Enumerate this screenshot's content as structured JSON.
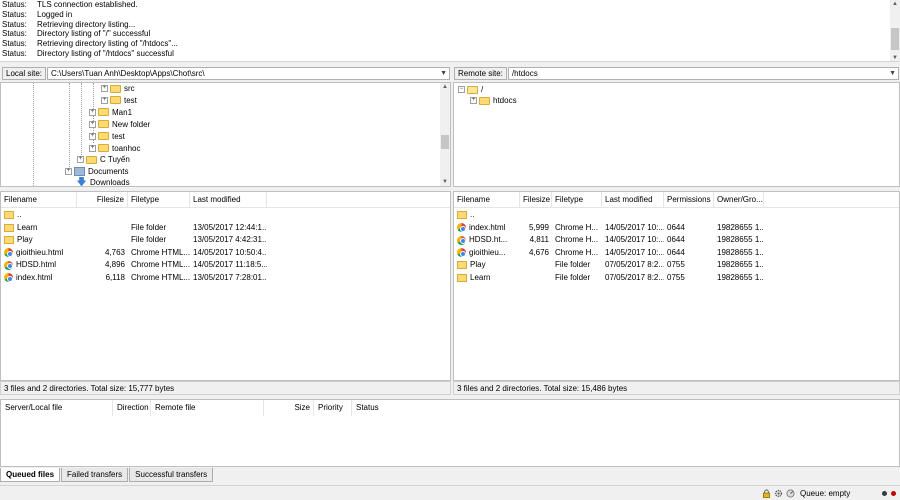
{
  "message_log": [
    {
      "kind": "Status:",
      "text": "TLS connection established."
    },
    {
      "kind": "Status:",
      "text": "Logged in"
    },
    {
      "kind": "Status:",
      "text": "Retrieving directory listing..."
    },
    {
      "kind": "Status:",
      "text": "Directory listing of \"/\" successful"
    },
    {
      "kind": "Status:",
      "text": "Retrieving directory listing of \"/htdocs\"..."
    },
    {
      "kind": "Status:",
      "text": "Directory listing of \"/htdocs\" successful"
    }
  ],
  "local": {
    "site_label": "Local site:",
    "path": "C:\\Users\\Tuan Anh\\Desktop\\Apps\\Chot\\src\\",
    "tree": [
      {
        "label": "src",
        "icon": "folder-icon"
      },
      {
        "label": "test",
        "icon": "folder-icon"
      },
      {
        "label": "Man1",
        "icon": "folder-icon"
      },
      {
        "label": "New folder",
        "icon": "folder-icon"
      },
      {
        "label": "test",
        "icon": "folder-icon"
      },
      {
        "label": "toanhoc",
        "icon": "folder-icon"
      },
      {
        "label": "C Tuyến",
        "icon": "folder-icon"
      },
      {
        "label": "Documents",
        "icon": "documents-icon"
      },
      {
        "label": "Downloads",
        "icon": "download-icon"
      }
    ],
    "columns": [
      "Filename",
      "Filesize",
      "Filetype",
      "Last modified"
    ],
    "files": [
      {
        "name": "..",
        "size": "",
        "type": "",
        "modified": "",
        "icon": "folder"
      },
      {
        "name": "Learn",
        "size": "",
        "type": "File folder",
        "modified": "13/05/2017 12:44:1...",
        "icon": "folder"
      },
      {
        "name": "Play",
        "size": "",
        "type": "File folder",
        "modified": "13/05/2017 4:42:31...",
        "icon": "folder"
      },
      {
        "name": "gioithieu.html",
        "size": "4,763",
        "type": "Chrome HTML...",
        "modified": "14/05/2017 10:50:4...",
        "icon": "chrome"
      },
      {
        "name": "HDSD.html",
        "size": "4,896",
        "type": "Chrome HTML...",
        "modified": "14/05/2017 11:18:5...",
        "icon": "chrome"
      },
      {
        "name": "index.html",
        "size": "6,118",
        "type": "Chrome HTML...",
        "modified": "13/05/2017 7:28:01...",
        "icon": "chrome"
      }
    ],
    "status": "3 files and 2 directories. Total size: 15,777 bytes"
  },
  "remote": {
    "site_label": "Remote site:",
    "path": "/htdocs",
    "tree": [
      {
        "label": "/",
        "icon": "folder-icon"
      },
      {
        "label": "htdocs",
        "icon": "folder-icon"
      }
    ],
    "columns": [
      "Filename",
      "Filesize",
      "Filetype",
      "Last modified",
      "Permissions",
      "Owner/Gro..."
    ],
    "files": [
      {
        "name": "..",
        "size": "",
        "type": "",
        "modified": "",
        "perm": "",
        "owner": "",
        "icon": "folder"
      },
      {
        "name": "index.html",
        "size": "5,999",
        "type": "Chrome H...",
        "modified": "14/05/2017 10:...",
        "perm": "0644",
        "owner": "19828655 1...",
        "icon": "chrome"
      },
      {
        "name": "HDSD.ht...",
        "size": "4,811",
        "type": "Chrome H...",
        "modified": "14/05/2017 10:...",
        "perm": "0644",
        "owner": "19828655 1...",
        "icon": "chrome"
      },
      {
        "name": "gioithieu...",
        "size": "4,676",
        "type": "Chrome H...",
        "modified": "14/05/2017 10:...",
        "perm": "0644",
        "owner": "19828655 1...",
        "icon": "chrome"
      },
      {
        "name": "Play",
        "size": "",
        "type": "File folder",
        "modified": "07/05/2017 8:2...",
        "perm": "0755",
        "owner": "19828655 1...",
        "icon": "folder"
      },
      {
        "name": "Learn",
        "size": "",
        "type": "File folder",
        "modified": "07/05/2017 8:2...",
        "perm": "0755",
        "owner": "19828655 1...",
        "icon": "folder"
      }
    ],
    "status": "3 files and 2 directories. Total size: 15,486 bytes"
  },
  "queue": {
    "columns": [
      "Server/Local file",
      "Direction",
      "Remote file",
      "Size",
      "Priority",
      "Status"
    ]
  },
  "tabs": [
    "Queued files",
    "Failed transfers",
    "Successful transfers"
  ],
  "bottom": {
    "queue_text": "Queue: empty",
    "icons": [
      "lock-icon",
      "gear-icon",
      "speed-limit-icon"
    ],
    "colors": {
      "lamp_off": "#3a3a3a",
      "lamp_red": "#c00000",
      "folder": "#ffd971"
    }
  }
}
